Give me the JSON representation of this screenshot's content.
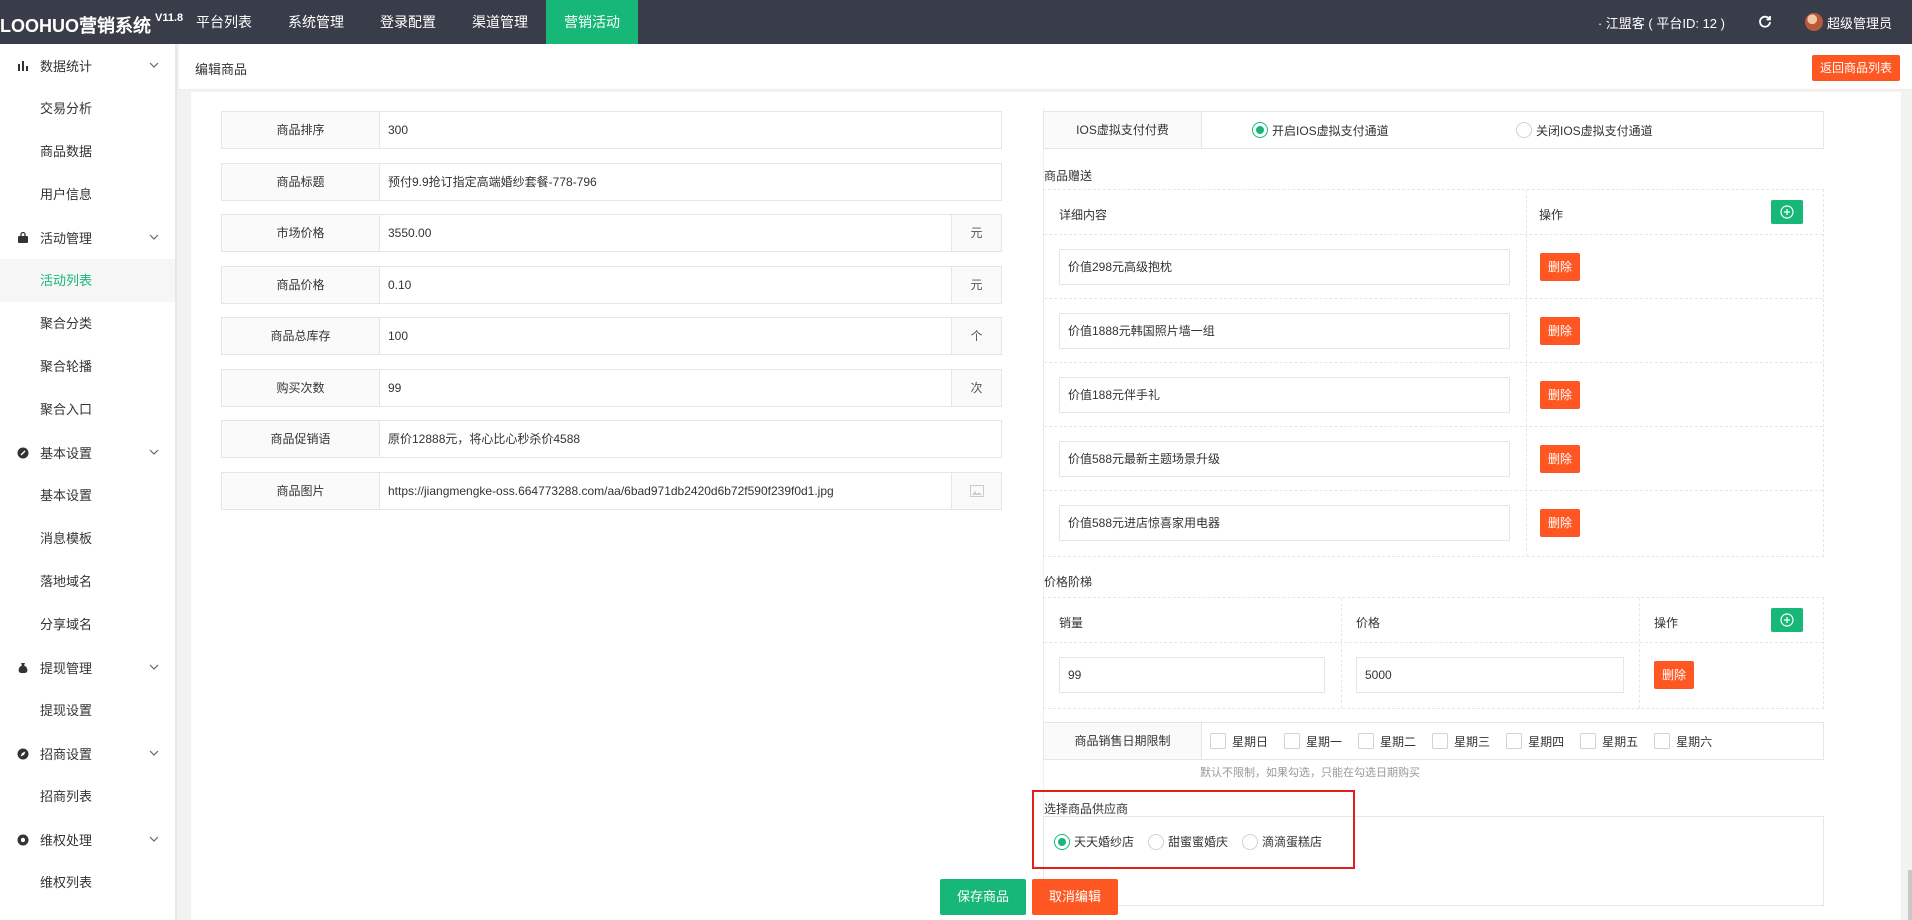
{
  "app": {
    "title": "LOOHUO营销系统",
    "version": "V11.8"
  },
  "topnav": [
    {
      "label": "平台列表"
    },
    {
      "label": "系统管理"
    },
    {
      "label": "登录配置"
    },
    {
      "label": "渠道管理"
    },
    {
      "label": "营销活动",
      "active": true
    }
  ],
  "header_right": {
    "merchant": "· 江盟客 ( 平台ID: 12 )",
    "user": "超级管理员",
    "refresh_icon": "refresh-icon"
  },
  "sidebar": {
    "groups": [
      {
        "label": "数据统计",
        "icon": "bar-chart-icon",
        "items": [
          "交易分析",
          "商品数据",
          "用户信息"
        ]
      },
      {
        "label": "活动管理",
        "icon": "bag-icon",
        "items": [
          "活动列表",
          "聚合分类",
          "聚合轮播",
          "聚合入口"
        ]
      },
      {
        "label": "基本设置",
        "icon": "settings-icon",
        "items": [
          "基本设置",
          "消息模板",
          "落地域名",
          "分享域名"
        ]
      },
      {
        "label": "提现管理",
        "icon": "money-bag-icon",
        "items": [
          "提现设置"
        ]
      },
      {
        "label": "招商设置",
        "icon": "compass-icon",
        "items": [
          "招商列表"
        ]
      },
      {
        "label": "维权处理",
        "icon": "shield-icon",
        "items": [
          "维权列表"
        ]
      }
    ],
    "active_item": "活动列表"
  },
  "page": {
    "title": "编辑商品",
    "back_button": "返回商品列表"
  },
  "form": {
    "fields": [
      {
        "label": "商品排序",
        "value": "300",
        "suffix": ""
      },
      {
        "label": "商品标题",
        "value": "预付9.9抢订指定高端婚纱套餐-778-796",
        "suffix": ""
      },
      {
        "label": "市场价格",
        "value": "3550.00",
        "suffix": "元"
      },
      {
        "label": "商品价格",
        "value": "0.10",
        "suffix": "元"
      },
      {
        "label": "商品总库存",
        "value": "100",
        "suffix": "个"
      },
      {
        "label": "购买次数",
        "value": "99",
        "suffix": "次"
      },
      {
        "label": "商品促销语",
        "value": "原价12888元，将心比心秒杀价4588",
        "suffix": ""
      },
      {
        "label": "商品图片",
        "value": "https://jiangmengke-oss.664773288.com/aa/6bad971db2420d6b72f590f239f0d1.jpg",
        "suffix": "image-icon"
      }
    ]
  },
  "ios": {
    "label": "IOS虚拟支付付费",
    "options": [
      {
        "label": "开启IOS虚拟支付通道",
        "checked": true
      },
      {
        "label": "关闭IOS虚拟支付通道",
        "checked": false
      }
    ]
  },
  "gifts": {
    "title": "商品赠送",
    "col_detail": "详细内容",
    "col_action": "操作",
    "delete_label": "删除",
    "items": [
      "价值298元高级抱枕",
      "价值1888元韩国照片墙一组",
      "价值188元伴手礼",
      "价值588元最新主题场景升级",
      "价值588元进店惊喜家用电器"
    ]
  },
  "tiers": {
    "title": "价格阶梯",
    "col_sales": "销量",
    "col_price": "价格",
    "col_action": "操作",
    "delete_label": "删除",
    "rows": [
      {
        "sales": "99",
        "price": "5000"
      }
    ]
  },
  "date_limit": {
    "label": "商品销售日期限制",
    "days": [
      "星期日",
      "星期一",
      "星期二",
      "星期三",
      "星期四",
      "星期五",
      "星期六"
    ],
    "hint": "默认不限制，如果勾选，只能在勾选日期购买"
  },
  "supplier": {
    "title": "选择商品供应商",
    "options": [
      {
        "label": "天天婚纱店",
        "checked": true
      },
      {
        "label": "甜蜜蜜婚庆",
        "checked": false
      },
      {
        "label": "滴滴蛋糕店",
        "checked": false
      }
    ]
  },
  "actions": {
    "save": "保存商品",
    "cancel": "取消编辑"
  },
  "colors": {
    "topbar": "#393d49",
    "accent_green": "#16b777",
    "accent_orange": "#ff5722",
    "highlight_red": "#e0201c"
  }
}
